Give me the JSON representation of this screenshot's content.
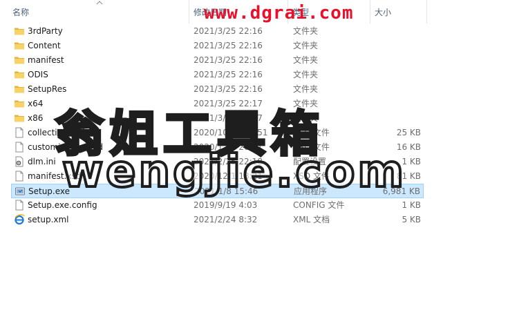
{
  "columns": {
    "name": "名称",
    "date": "修改日期",
    "type": "类型",
    "size": "大小"
  },
  "watermark": {
    "url": "www.dgrai.com",
    "cn": "翁姐工具箱",
    "en": "wengjie.com"
  },
  "files": [
    {
      "name": "3rdParty",
      "date": "2021/3/25 22:16",
      "type": "文件夹",
      "size": "",
      "icon": "folder-icon"
    },
    {
      "name": "Content",
      "date": "2021/3/25 22:16",
      "type": "文件夹",
      "size": "",
      "icon": "folder-icon"
    },
    {
      "name": "manifest",
      "date": "2021/3/25 22:16",
      "type": "文件夹",
      "size": "",
      "icon": "folder-icon"
    },
    {
      "name": "ODIS",
      "date": "2021/3/25 22:16",
      "type": "文件夹",
      "size": "",
      "icon": "folder-icon"
    },
    {
      "name": "SetupRes",
      "date": "2021/3/25 22:16",
      "type": "文件夹",
      "size": "",
      "icon": "folder-icon"
    },
    {
      "name": "x64",
      "date": "2021/3/25 22:17",
      "type": "文件夹",
      "size": "",
      "icon": "folder-icon"
    },
    {
      "name": "x86",
      "date": "2021/3/25 22:17",
      "type": "文件夹",
      "size": "",
      "icon": "folder-icon"
    },
    {
      "name": "collection.xsd",
      "date": "2020/10/28 22:51",
      "type": "XSD 文件",
      "size": "25 KB",
      "icon": "file-icon"
    },
    {
      "name": "customization.xsd",
      "date": "2020/12/3 20:31",
      "type": "XSD 文件",
      "size": "16 KB",
      "icon": "file-icon"
    },
    {
      "name": "dlm.ini",
      "date": "2021/2/25 22:18",
      "type": "配置设置",
      "size": "1 KB",
      "icon": "settings-file-icon"
    },
    {
      "name": "manifest.xsd",
      "date": "2020/12/1 18:21",
      "type": "XSD 文件",
      "size": "81 KB",
      "icon": "file-icon"
    },
    {
      "name": "Setup.exe",
      "date": "2021/1/8 15:46",
      "type": "应用程序",
      "size": "6,981 KB",
      "icon": "setup-exe-icon",
      "selected": true
    },
    {
      "name": "Setup.exe.config",
      "date": "2019/9/19 4:03",
      "type": "CONFIG 文件",
      "size": "1 KB",
      "icon": "file-icon"
    },
    {
      "name": "setup.xml",
      "date": "2021/2/24 8:32",
      "type": "XML 文档",
      "size": "5 KB",
      "icon": "ie-xml-icon"
    }
  ],
  "colors": {
    "selection_bg": "#cce8ff",
    "selection_border": "#99d1ff",
    "folder": "#f4c84d",
    "header_text": "#4c607a",
    "watermark_url": "#e8102a"
  }
}
